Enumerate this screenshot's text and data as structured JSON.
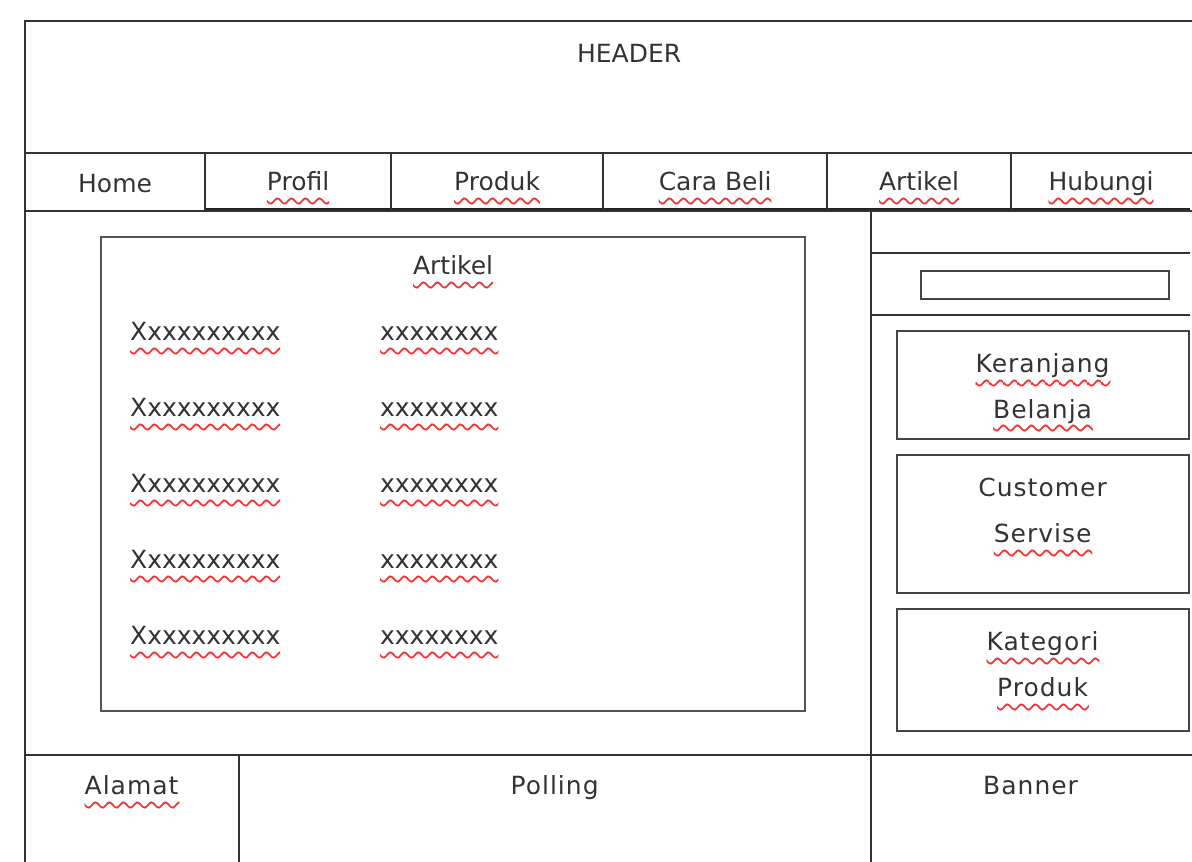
{
  "header": {
    "title": "HEADER",
    "flagged": false
  },
  "nav": [
    {
      "label": "Home",
      "flagged": false
    },
    {
      "label": "Profil",
      "flagged": true
    },
    {
      "label": "Produk",
      "flagged": true
    },
    {
      "label": "Cara Beli",
      "flagged": true
    },
    {
      "label": "Artikel",
      "flagged": true
    },
    {
      "label": "Hubungi",
      "flagged": true
    }
  ],
  "article": {
    "title": "Artikel",
    "flagged": true,
    "rows": [
      [
        "Xxxxxxxxxx",
        "xxxxxxxx"
      ],
      [
        "Xxxxxxxxxx",
        "xxxxxxxx"
      ],
      [
        "Xxxxxxxxxx",
        "xxxxxxxx"
      ],
      [
        "Xxxxxxxxxx",
        "xxxxxxxx"
      ],
      [
        "Xxxxxxxxxx",
        "xxxxxxxx"
      ]
    ],
    "flagged_rows": true
  },
  "sidebar": {
    "boxes": [
      {
        "lines": [
          {
            "text": "Keranjang",
            "flagged": true
          },
          {
            "text": "Belanja",
            "flagged": true
          }
        ]
      },
      {
        "lines": [
          {
            "text": "Customer",
            "flagged": false
          },
          {
            "text": "Servise",
            "flagged": true
          }
        ]
      },
      {
        "lines": [
          {
            "text": "Kategori",
            "flagged": true
          },
          {
            "text": "Produk",
            "flagged": true
          }
        ]
      }
    ]
  },
  "footer": [
    {
      "label": "Alamat",
      "flagged": true
    },
    {
      "label": "Polling",
      "flagged": false
    },
    {
      "label": "Banner",
      "flagged": false
    }
  ]
}
